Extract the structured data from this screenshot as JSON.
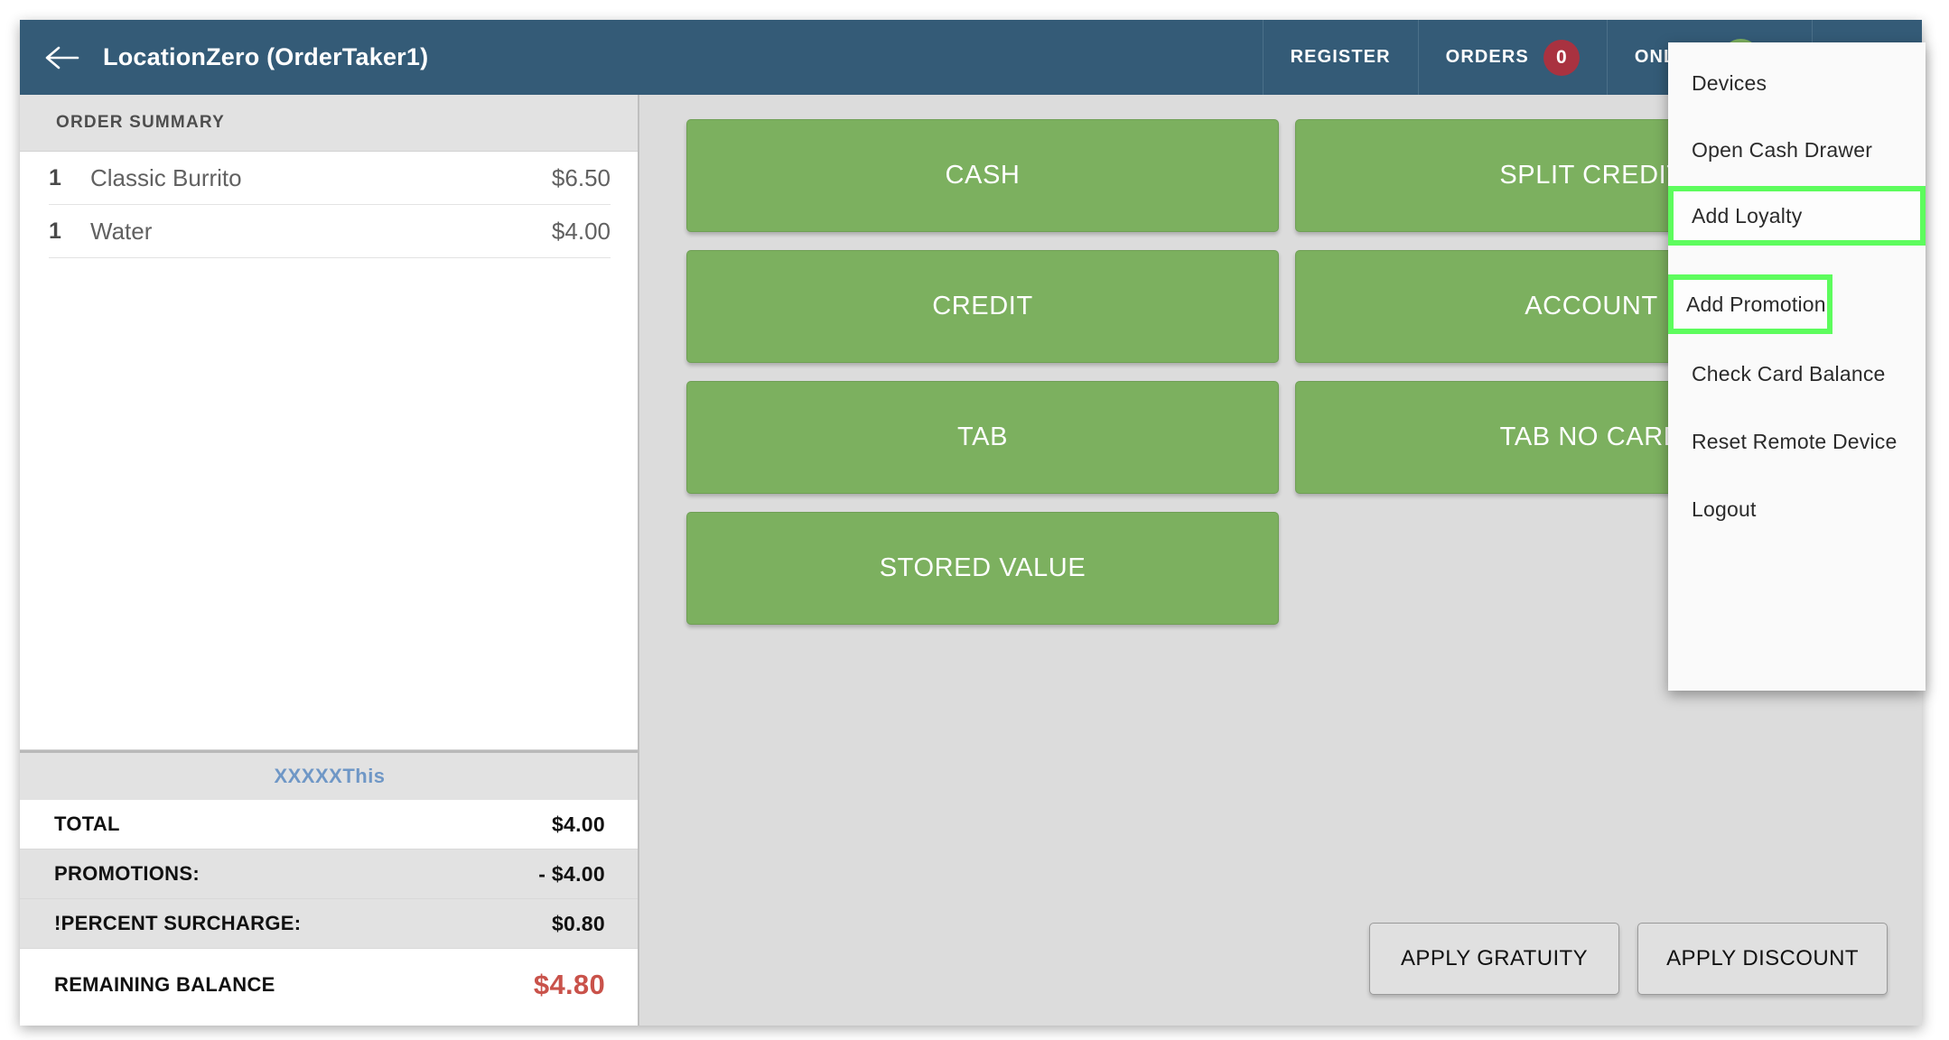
{
  "header": {
    "back_icon": "arrow-left-icon",
    "title": "LocationZero (OrderTaker1)",
    "register_label": "REGISTER",
    "orders_label": "ORDERS",
    "orders_count": "0",
    "online_label": "ONLINE",
    "online_state": "on",
    "tag_icon": "tag-icon",
    "background_color": "#345b77",
    "badge_color": "#a93240",
    "toggle_on_color": "#7cb05f"
  },
  "sidebar": {
    "summary_header": "ORDER SUMMARY",
    "items": [
      {
        "qty": "1",
        "name": "Classic Burrito",
        "price": "$6.50"
      },
      {
        "qty": "1",
        "name": "Water",
        "price": "$4.00"
      }
    ],
    "order_reference": "XXXXXThis",
    "totals": [
      {
        "label": "TOTAL",
        "value": "$4.00"
      },
      {
        "label": "PROMOTIONS:",
        "value": "- $4.00"
      },
      {
        "label": "!PERCENT SURCHARGE:",
        "value": "$0.80"
      }
    ],
    "balance": {
      "label": "REMAINING BALANCE",
      "value": "$4.80",
      "color": "#c9524a"
    }
  },
  "main": {
    "payment_buttons": [
      "CASH",
      "SPLIT CREDIT",
      "CREDIT",
      "ACCOUNT",
      "TAB",
      "TAB NO CARD",
      "STORED VALUE"
    ],
    "payment_button_color": "#7cb05f",
    "actions": [
      "APPLY GRATUITY",
      "APPLY DISCOUNT"
    ]
  },
  "dropdown_menu": {
    "highlight_color": "#5dfc5d",
    "items": [
      {
        "label": "Devices",
        "highlighted": false
      },
      {
        "label": "Open Cash Drawer",
        "highlighted": false
      },
      {
        "label": "Add Loyalty",
        "highlighted": true
      },
      {
        "label": "Add Promotion",
        "highlighted": true
      },
      {
        "label": "Check Card Balance",
        "highlighted": false
      },
      {
        "label": "Reset Remote Device",
        "highlighted": false
      },
      {
        "label": "Logout",
        "highlighted": false
      }
    ]
  }
}
